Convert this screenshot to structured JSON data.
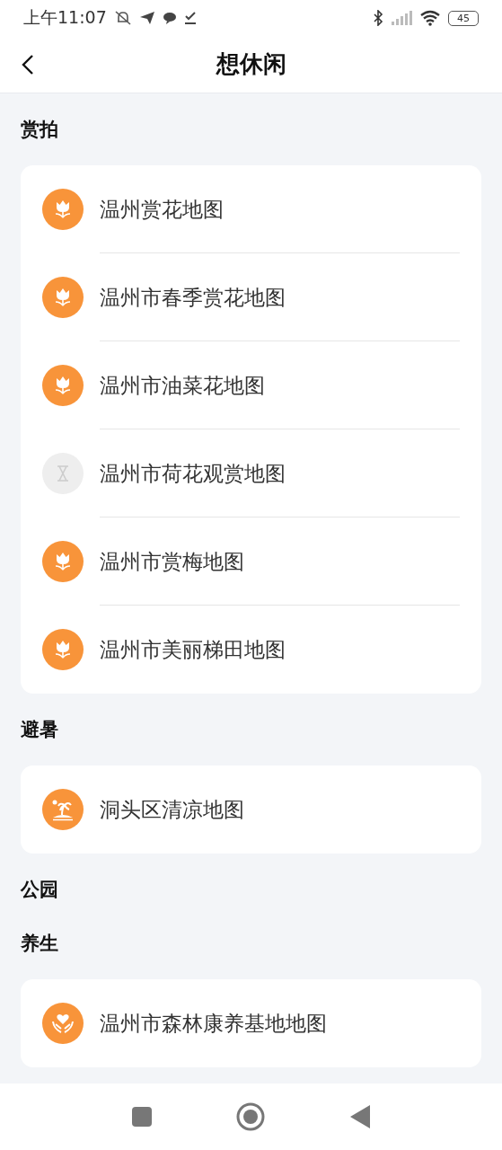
{
  "status_bar": {
    "time": "上午11:07",
    "battery": "45"
  },
  "header": {
    "title": "想休闲"
  },
  "sections": [
    {
      "title": "赏拍",
      "items": [
        {
          "label": "温州赏花地图",
          "kind": "flower"
        },
        {
          "label": "温州市春季赏花地图",
          "kind": "flower"
        },
        {
          "label": "温州市油菜花地图",
          "kind": "flower"
        },
        {
          "label": "温州市荷花观赏地图",
          "kind": "hourglass"
        },
        {
          "label": "温州市赏梅地图",
          "kind": "flower"
        },
        {
          "label": "温州市美丽梯田地图",
          "kind": "flower"
        }
      ]
    },
    {
      "title": "避暑",
      "items": [
        {
          "label": "洞头区清凉地图",
          "kind": "island"
        }
      ]
    },
    {
      "title": "公园"
    },
    {
      "title": "养生",
      "items": [
        {
          "label": "温州市森林康养基地地图",
          "kind": "care"
        }
      ]
    }
  ]
}
